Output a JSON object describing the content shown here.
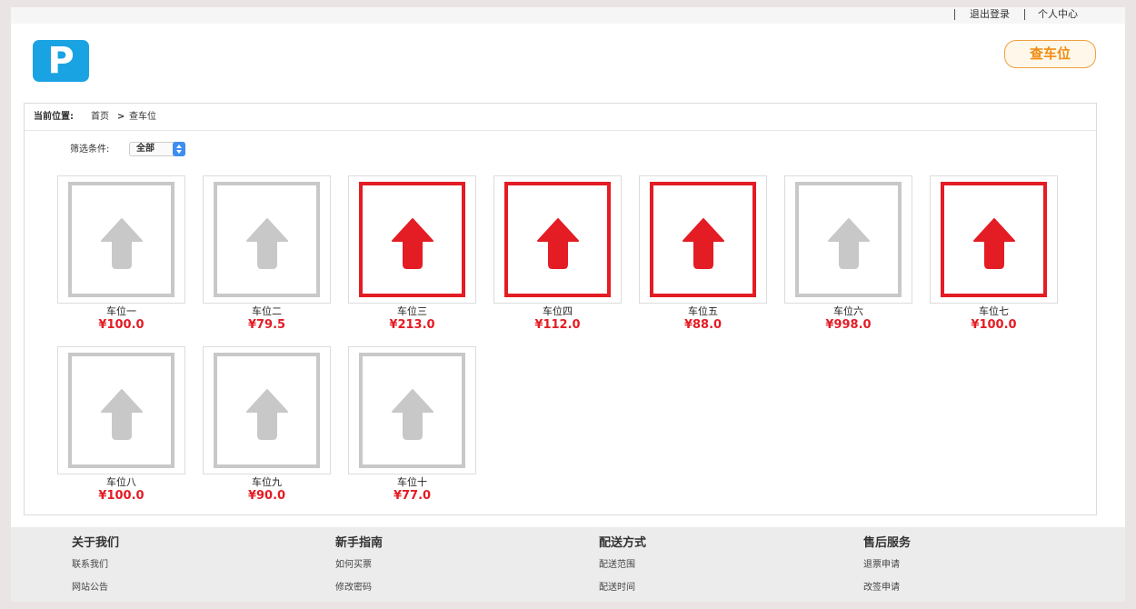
{
  "topbar": {
    "logout": "退出登录",
    "user_center": "个人中心"
  },
  "header": {
    "logo_icon": "parking-p-logo",
    "logo_letter": "P",
    "find_button": "查车位",
    "accent_color": "#f08c14"
  },
  "breadcrumb": {
    "label": "当前位置:",
    "home": "首页",
    "arrow": ">",
    "current": "查车位"
  },
  "filter": {
    "label": "筛选条件:",
    "selected": "全部"
  },
  "colors": {
    "occupied": "#e41c24",
    "free": "#c8c8c8"
  },
  "spots": [
    {
      "name": "车位一",
      "price": "¥100.0",
      "status": "free"
    },
    {
      "name": "车位二",
      "price": "¥79.5",
      "status": "free"
    },
    {
      "name": "车位三",
      "price": "¥213.0",
      "status": "occupied"
    },
    {
      "name": "车位四",
      "price": "¥112.0",
      "status": "occupied"
    },
    {
      "name": "车位五",
      "price": "¥88.0",
      "status": "occupied"
    },
    {
      "name": "车位六",
      "price": "¥998.0",
      "status": "free"
    },
    {
      "name": "车位七",
      "price": "¥100.0",
      "status": "occupied"
    },
    {
      "name": "车位八",
      "price": "¥100.0",
      "status": "free"
    },
    {
      "name": "车位九",
      "price": "¥90.0",
      "status": "free"
    },
    {
      "name": "车位十",
      "price": "¥77.0",
      "status": "free"
    }
  ],
  "footer": {
    "columns": [
      {
        "title": "关于我们",
        "links": [
          "联系我们",
          "网站公告"
        ]
      },
      {
        "title": "新手指南",
        "links": [
          "如何买票",
          "修改密码"
        ]
      },
      {
        "title": "配送方式",
        "links": [
          "配送范围",
          "配送时间"
        ]
      },
      {
        "title": "售后服务",
        "links": [
          "退票申请",
          "改签申请"
        ]
      }
    ]
  }
}
